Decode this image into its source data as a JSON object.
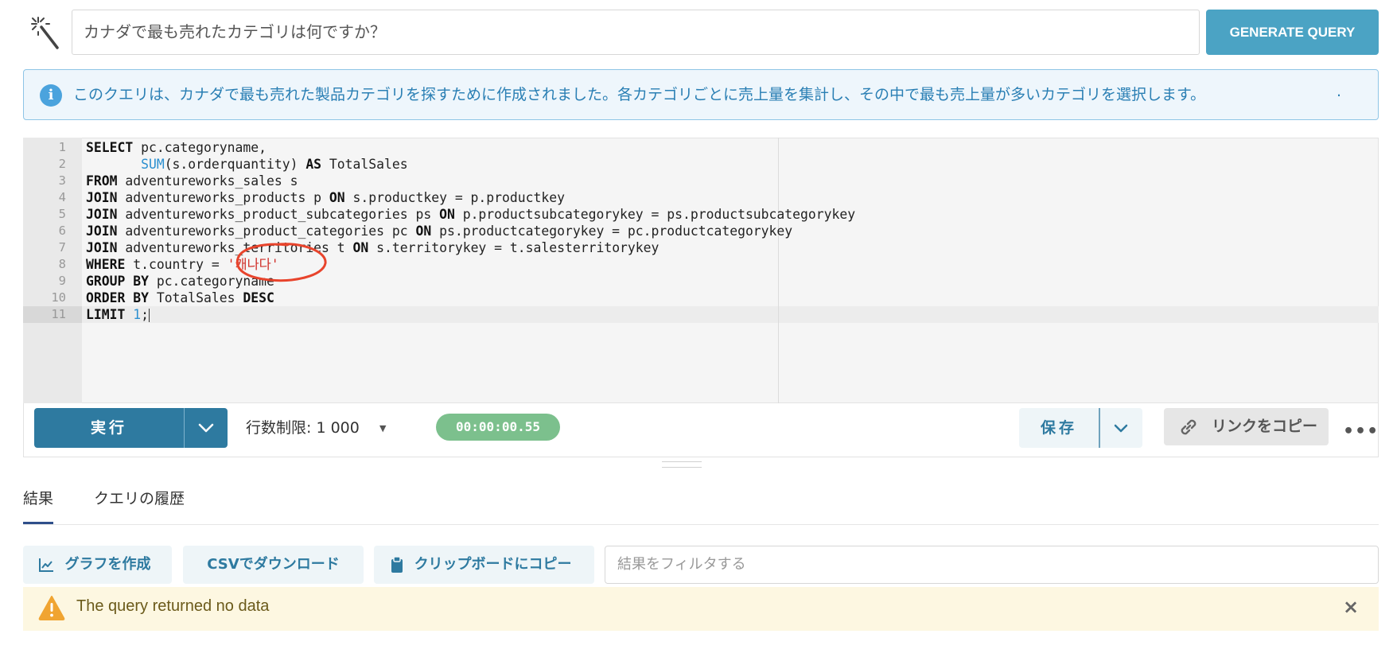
{
  "prompt": {
    "question": "カナダで最も売れたカテゴリは何ですか？",
    "generate_label": "GENERATE QUERY"
  },
  "info": {
    "text": "このクエリは、カナダで最も売れた製品カテゴリを探すために作成されました。各カテゴリごとに売上量を集計し、その中で最も売上量が多いカテゴリを選択します。",
    "trailing": "."
  },
  "editor": {
    "line_numbers": [
      "1",
      "2",
      "3",
      "4",
      "5",
      "6",
      "7",
      "8",
      "9",
      "10",
      "11"
    ],
    "lines": {
      "l1_kw": "SELECT",
      "l1_rest": " pc.categoryname,",
      "l2_indent": "       ",
      "l2_fn": "SUM",
      "l2_mid": "(s.orderquantity) ",
      "l2_kw": "AS",
      "l2_rest": " TotalSales",
      "l3_kw": "FROM",
      "l3_rest": " adventureworks_sales s",
      "l4_kw": "JOIN",
      "l4_mid": " adventureworks_products p ",
      "l4_kw2": "ON",
      "l4_rest": " s.productkey = p.productkey",
      "l5_kw": "JOIN",
      "l5_mid": " adventureworks_product_subcategories ps ",
      "l5_kw2": "ON",
      "l5_rest": " p.productsubcategorykey = ps.productsubcategorykey",
      "l6_kw": "JOIN",
      "l6_mid": " adventureworks_product_categories pc ",
      "l6_kw2": "ON",
      "l6_rest": " ps.productcategorykey = pc.productcategorykey",
      "l7_kw": "JOIN",
      "l7_mid": " adventureworks_territories t ",
      "l7_kw2": "ON",
      "l7_rest": " s.territorykey = t.salesterritorykey",
      "l8_kw": "WHERE",
      "l8_mid": " t.country = ",
      "l8_str": "'캐나다'",
      "l9_kw": "GROUP BY",
      "l9_rest": " pc.categoryname",
      "l10_kw": "ORDER BY",
      "l10_mid": " TotalSales ",
      "l10_kw2": "DESC",
      "l11_kw": "LIMIT",
      "l11_sp": " ",
      "l11_num": "1",
      "l11_end": ";"
    },
    "annotation_color": "#e8442c"
  },
  "toolbar": {
    "run_label": "実行",
    "row_limit_label": "行数制限:",
    "row_limit_value": "1 000",
    "timer": "00:00:00.55",
    "save_label": "保存",
    "copy_link_label": "リンクをコピー",
    "more_label": "•••"
  },
  "tabs": {
    "results": "結果",
    "history": "クエリの履歴"
  },
  "actions": {
    "graph": "グラフを作成",
    "csv": "CSVでダウンロード",
    "clipboard": "クリップボードにコピー",
    "filter_placeholder": "結果をフィルタする"
  },
  "warning": {
    "text": "The query returned no data",
    "close": "×"
  }
}
